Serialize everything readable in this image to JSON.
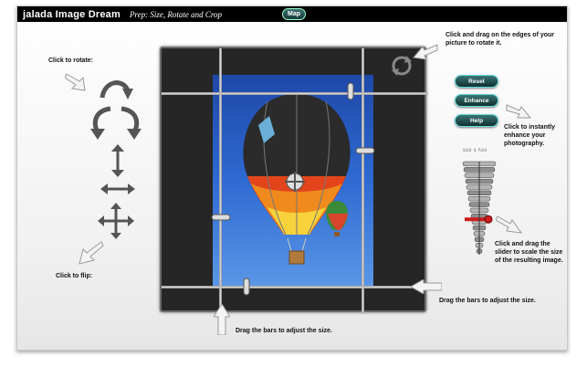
{
  "app": {
    "name": "jalada Image Dream",
    "subtitle": "Prep: Size, Rotate and Crop",
    "map_label": "Map"
  },
  "labels": {
    "rotate": "Click to rotate:",
    "flip": "Click to flip:",
    "rotate_edges": "Click and drag on the edges of your picture to rotate it.",
    "enhance_hint": "Click to instantly enhance your photography.",
    "slider_hint": "Click and drag the slider to scale the size of the resulting image.",
    "bars_right": "Drag the bars to adjust the size.",
    "bars_bottom": "Drag the bars to adjust the size."
  },
  "buttons": {
    "reset": "Reset",
    "enhance": "Enhance",
    "help": "Help"
  },
  "slider": {
    "top_label": "ääã ä ñäé",
    "level": 0.62,
    "marker_color": "#cc1d1d"
  },
  "colors": {
    "stage": "#262626",
    "sky": "#2f6ad2",
    "button": "#1f4c4c"
  },
  "icons": [
    "rotate-clockwise-icon",
    "rotate-counterclockwise-icon",
    "rotate-clockwise-icon",
    "flip-vertical-icon",
    "flip-horizontal-icon",
    "flip-both-icon",
    "rotate-handle-icon",
    "hint-arrow-icon"
  ]
}
